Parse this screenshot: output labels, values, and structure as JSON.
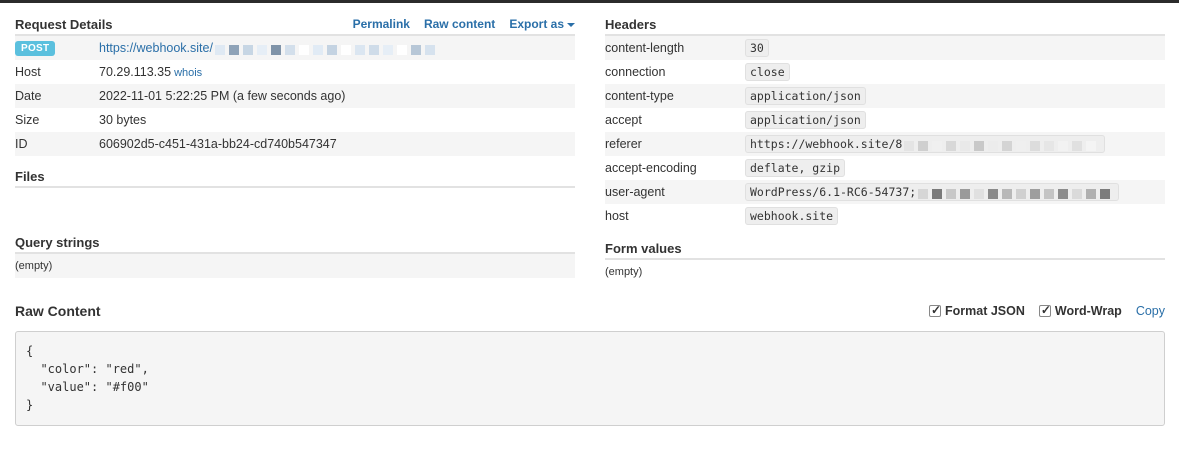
{
  "request_details": {
    "title": "Request Details",
    "permalink_label": "Permalink",
    "raw_content_label": "Raw content",
    "export_label": "Export as",
    "method": "POST",
    "url_prefix": "https://webhook.site/",
    "rows": [
      {
        "label": "Host",
        "value": "70.29.113.35",
        "extra": "whois"
      },
      {
        "label": "Date",
        "value": "2022-11-01 5:22:25 PM (a few seconds ago)"
      },
      {
        "label": "Size",
        "value": "30 bytes"
      },
      {
        "label": "ID",
        "value": "606902d5-c451-431a-bb24-cd740b547347"
      }
    ]
  },
  "files": {
    "title": "Files"
  },
  "query_strings": {
    "title": "Query strings",
    "empty": "(empty)"
  },
  "headers": {
    "title": "Headers",
    "rows": [
      {
        "name": "content-length",
        "value": "30"
      },
      {
        "name": "connection",
        "value": "close"
      },
      {
        "name": "content-type",
        "value": "application/json"
      },
      {
        "name": "accept",
        "value": "application/json"
      },
      {
        "name": "referer",
        "value": "https://webhook.site/8"
      },
      {
        "name": "accept-encoding",
        "value": "deflate, gzip"
      },
      {
        "name": "user-agent",
        "value": "WordPress/6.1-RC6-54737;"
      },
      {
        "name": "host",
        "value": "webhook.site"
      }
    ]
  },
  "form_values": {
    "title": "Form values",
    "empty": "(empty)"
  },
  "raw_content": {
    "title": "Raw Content",
    "format_json_label": "Format JSON",
    "word_wrap_label": "Word-Wrap",
    "copy_label": "Copy",
    "body": "{\n  \"color\": \"red\",\n  \"value\": \"#f00\"\n}"
  },
  "colors": {
    "link": "#2a6fa8",
    "badge": "#5bc0de"
  }
}
